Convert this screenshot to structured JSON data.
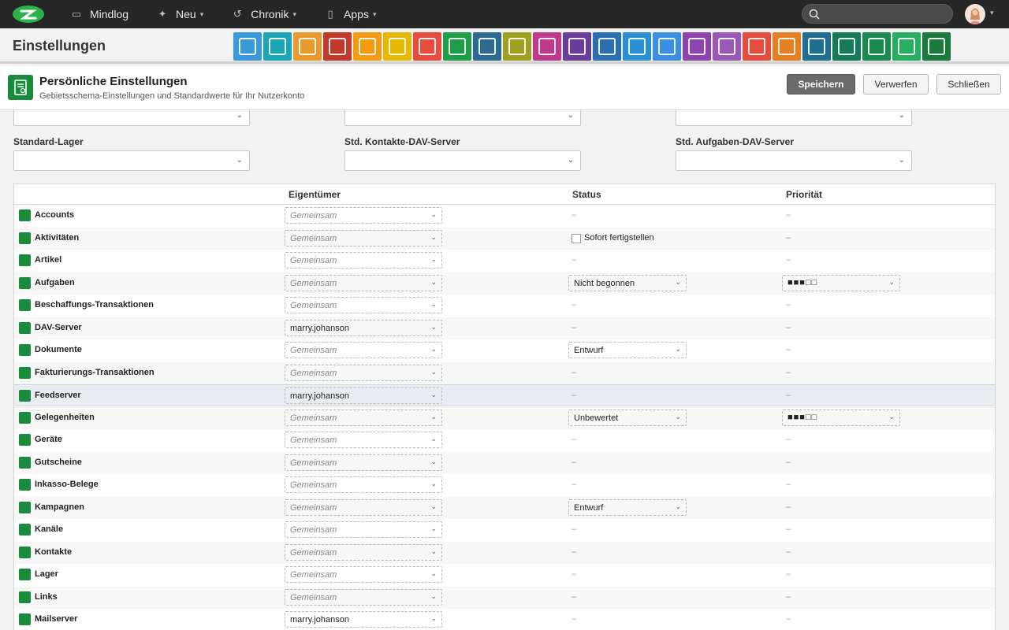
{
  "topbar": {
    "brand": "Mindlog",
    "nav": [
      {
        "label": "Neu",
        "icon": "sparkle-icon"
      },
      {
        "label": "Chronik",
        "icon": "history-icon"
      },
      {
        "label": "Apps",
        "icon": "tablet-icon"
      }
    ],
    "search_placeholder": ""
  },
  "header": {
    "title": "Einstellungen"
  },
  "app_icons": [
    {
      "name": "mail-app-icon",
      "color": "#3a9ad9"
    },
    {
      "name": "email-app-icon",
      "color": "#1ba6b8"
    },
    {
      "name": "contacts-app-icon",
      "color": "#e89a2c"
    },
    {
      "name": "calendar-app-icon",
      "color": "#c0392b"
    },
    {
      "name": "timer-app-icon",
      "color": "#f39c12"
    },
    {
      "name": "tasks-app-icon",
      "color": "#e6b800"
    },
    {
      "name": "inbox-app-icon",
      "color": "#e74c3c"
    },
    {
      "name": "notes-app-icon",
      "color": "#1f9e4a"
    },
    {
      "name": "bookmark-app-icon",
      "color": "#2c6b8f"
    },
    {
      "name": "document-app-icon",
      "color": "#a0a020"
    },
    {
      "name": "cashier-app-icon",
      "color": "#c0398a"
    },
    {
      "name": "dollar-app-icon",
      "color": "#6a3d9a"
    },
    {
      "name": "truck-app-icon",
      "color": "#2a6fb0"
    },
    {
      "name": "recycle-app-icon",
      "color": "#2a8fd0"
    },
    {
      "name": "moneybag-app-icon",
      "color": "#3a8fe0"
    },
    {
      "name": "contract-app-icon",
      "color": "#8e44ad"
    },
    {
      "name": "handshake-app-icon",
      "color": "#9b59b6"
    },
    {
      "name": "invoice-app-icon",
      "color": "#e74c3c"
    },
    {
      "name": "broadcast-app-icon",
      "color": "#e67e22"
    },
    {
      "name": "download-app-icon",
      "color": "#1e6f8f"
    },
    {
      "name": "cart-app-icon",
      "color": "#147a5a"
    },
    {
      "name": "coins-app-icon",
      "color": "#1a8a50"
    },
    {
      "name": "voucher-app-icon",
      "color": "#27ae60"
    },
    {
      "name": "database-app-icon",
      "color": "#1a7a3c"
    }
  ],
  "panel": {
    "title": "Persönliche Einstellungen",
    "subtitle": "Gebietsschema-Einstellungen und Standardwerte für Ihr Nutzerkonto",
    "save": "Speichern",
    "discard": "Verwerfen",
    "close": "Schließen"
  },
  "fields": {
    "standard_lager": "Standard-Lager",
    "contacts_dav": "Std. Kontakte-DAV-Server",
    "tasks_dav": "Std. Aufgaben-DAV-Server"
  },
  "table": {
    "headers": {
      "owner": "Eigentümer",
      "status": "Status",
      "priority": "Priorität"
    },
    "dash": "–",
    "rows": [
      {
        "name": "Accounts",
        "owner": "Gemeinsam",
        "owner_set": false,
        "status": "",
        "priority": ""
      },
      {
        "name": "Aktivitäten",
        "owner": "Gemeinsam",
        "owner_set": false,
        "status_check": "Sofort fertigstellen",
        "priority": ""
      },
      {
        "name": "Artikel",
        "owner": "Gemeinsam",
        "owner_set": false,
        "status": "",
        "priority": ""
      },
      {
        "name": "Aufgaben",
        "owner": "Gemeinsam",
        "owner_set": false,
        "status": "Nicht begonnen",
        "priority": "■■■□□"
      },
      {
        "name": "Beschaffungs-Transaktionen",
        "owner": "Gemeinsam",
        "owner_set": false,
        "status": "",
        "priority": ""
      },
      {
        "name": "DAV-Server",
        "owner": "marry.johanson",
        "owner_set": true,
        "status": "",
        "priority": ""
      },
      {
        "name": "Dokumente",
        "owner": "Gemeinsam",
        "owner_set": false,
        "status": "Entwurf",
        "priority": ""
      },
      {
        "name": "Fakturierungs-Transaktionen",
        "owner": "Gemeinsam",
        "owner_set": false,
        "status": "",
        "priority": ""
      },
      {
        "name": "Feedserver",
        "owner": "marry.johanson",
        "owner_set": true,
        "status": "",
        "priority": "",
        "highlight": true
      },
      {
        "name": "Gelegenheiten",
        "owner": "Gemeinsam",
        "owner_set": false,
        "status": "Unbewertet",
        "priority": "■■■□□"
      },
      {
        "name": "Geräte",
        "owner": "Gemeinsam",
        "owner_set": false,
        "status": "",
        "priority": ""
      },
      {
        "name": "Gutscheine",
        "owner": "Gemeinsam",
        "owner_set": false,
        "status": "",
        "priority": ""
      },
      {
        "name": "Inkasso-Belege",
        "owner": "Gemeinsam",
        "owner_set": false,
        "status": "",
        "priority": ""
      },
      {
        "name": "Kampagnen",
        "owner": "Gemeinsam",
        "owner_set": false,
        "status": "Entwurf",
        "priority": ""
      },
      {
        "name": "Kanäle",
        "owner": "Gemeinsam",
        "owner_set": false,
        "status": "",
        "priority": ""
      },
      {
        "name": "Kontakte",
        "owner": "Gemeinsam",
        "owner_set": false,
        "status": "",
        "priority": ""
      },
      {
        "name": "Lager",
        "owner": "Gemeinsam",
        "owner_set": false,
        "status": "",
        "priority": ""
      },
      {
        "name": "Links",
        "owner": "Gemeinsam",
        "owner_set": false,
        "status": "",
        "priority": ""
      },
      {
        "name": "Mailserver",
        "owner": "marry.johanson",
        "owner_set": true,
        "status": "",
        "priority": ""
      }
    ]
  },
  "colors": {
    "accent": "#1a8a3c",
    "topbar": "#262626"
  }
}
